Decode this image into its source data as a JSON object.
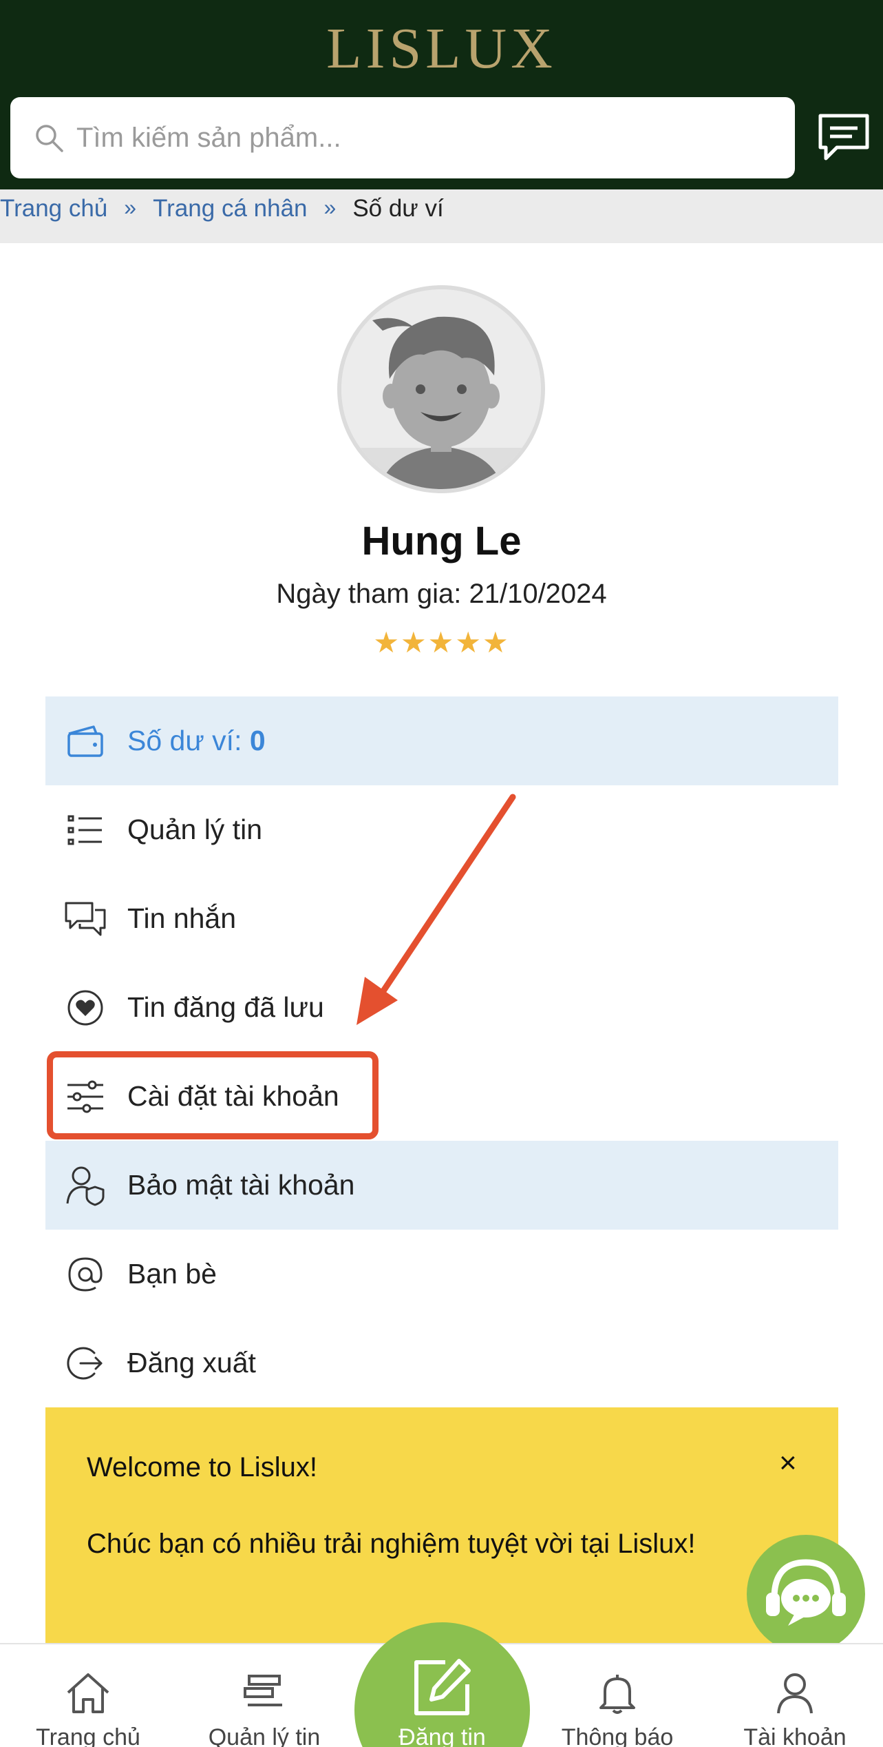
{
  "header": {
    "logo": "LISLUX",
    "search_placeholder": "Tìm kiếm sản phẩm...",
    "icons": [
      "search-icon",
      "chat-icon"
    ]
  },
  "breadcrumb": {
    "items": [
      "Trang chủ",
      "Trang cá nhân",
      "Số dư ví"
    ],
    "separator": "»"
  },
  "profile": {
    "name": "Hung Le",
    "joined": "Ngày tham gia: 21/10/2024",
    "stars": "★★★★★",
    "rating": 5
  },
  "menu": {
    "wallet_label": "Số dư ví: ",
    "wallet_value": "0",
    "items": [
      {
        "label": "Quản lý tin",
        "icon": "list-icon"
      },
      {
        "label": "Tin nhắn",
        "icon": "messages-icon"
      },
      {
        "label": "Tin đăng đã lưu",
        "icon": "heart-icon"
      },
      {
        "label": "Cài đặt tài khoản",
        "icon": "sliders-icon"
      },
      {
        "label": "Bảo mật tài khoản",
        "icon": "user-shield-icon"
      },
      {
        "label": "Bạn bè",
        "icon": "at-icon"
      },
      {
        "label": "Đăng xuất",
        "icon": "logout-icon"
      }
    ]
  },
  "banner": {
    "title": "Welcome to Lislux!",
    "message": "Chúc bạn có nhiều trải nghiệm tuyệt vời tại Lislux!",
    "close": "×"
  },
  "bottom_nav": {
    "items": [
      {
        "label": "Trang chủ",
        "icon": "home-icon"
      },
      {
        "label": "Quản lý tin",
        "icon": "manage-icon"
      },
      {
        "label": "Đăng tin",
        "icon": "edit-icon"
      },
      {
        "label": "Thông báo",
        "icon": "bell-icon"
      },
      {
        "label": "Tài khoản",
        "icon": "user-icon"
      }
    ]
  },
  "colors": {
    "header_bg": "#0f2a12",
    "logo_gold": "#b9a36e",
    "link_blue": "#3a6aa8",
    "wallet_blue": "#3b86d8",
    "highlight_row": "#e3eef7",
    "annotation_red": "#e4502f",
    "banner_yellow": "#f7d84a",
    "accent_green": "#8bc04f",
    "star_gold": "#f2b43a"
  }
}
